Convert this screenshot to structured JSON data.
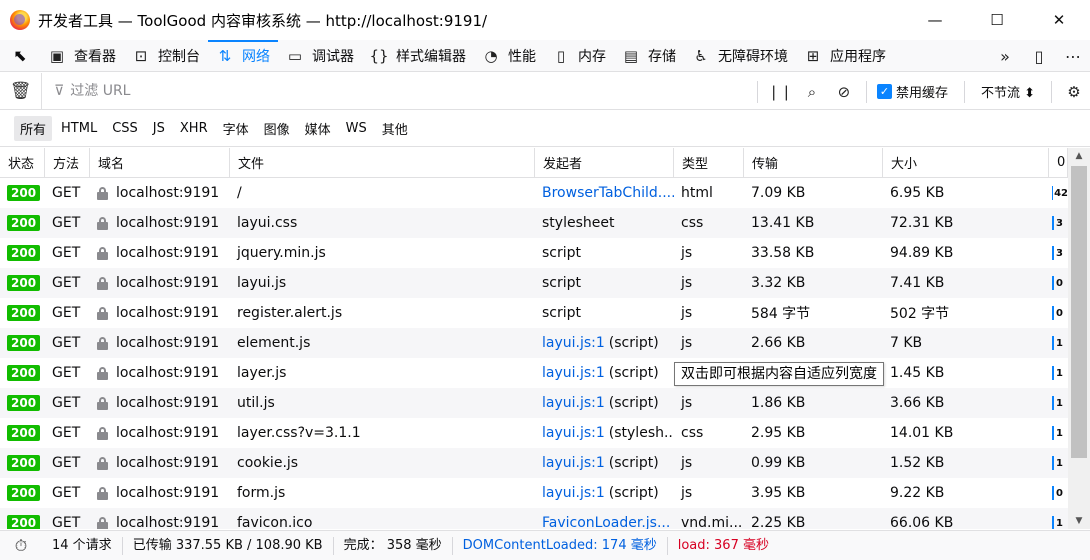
{
  "window": {
    "title": "开发者工具 — ToolGood 内容审核系统 — http://localhost:9191/",
    "buttons": {
      "minimize": "—",
      "maximize": "☐",
      "close": "✕"
    }
  },
  "toolbox": {
    "tabs": [
      {
        "label": "查看器",
        "icon": "inspector-icon"
      },
      {
        "label": "控制台",
        "icon": "console-icon"
      },
      {
        "label": "网络",
        "icon": "network-icon",
        "active": true
      },
      {
        "label": "调试器",
        "icon": "debugger-icon"
      },
      {
        "label": "样式编辑器",
        "icon": "style-editor-icon"
      },
      {
        "label": "性能",
        "icon": "performance-icon"
      },
      {
        "label": "内存",
        "icon": "memory-icon"
      },
      {
        "label": "存储",
        "icon": "storage-icon"
      },
      {
        "label": "无障碍环境",
        "icon": "accessibility-icon"
      },
      {
        "label": "应用程序",
        "icon": "application-icon"
      }
    ]
  },
  "filter": {
    "placeholder": "过滤 URL",
    "disable_cache_label": "禁用缓存",
    "disable_cache_checked": true,
    "throttle_label": "不节流 ⬍"
  },
  "type_filters": [
    "所有",
    "HTML",
    "CSS",
    "JS",
    "XHR",
    "字体",
    "图像",
    "媒体",
    "WS",
    "其他"
  ],
  "columns": {
    "status": "状态",
    "method": "方法",
    "domain": "域名",
    "file": "文件",
    "initiator": "发起者",
    "type": "类型",
    "transferred": "传输",
    "size": "大小",
    "waterfall": "0"
  },
  "requests": [
    {
      "status": "200",
      "method": "GET",
      "domain": "localhost:9191",
      "file": "/",
      "initiator_link": "BrowserTabChild....",
      "initiator_rest": "",
      "type": "html",
      "transferred": "7.09 KB",
      "size": "6.95 KB",
      "waterfall": "42"
    },
    {
      "status": "200",
      "method": "GET",
      "domain": "localhost:9191",
      "file": "layui.css",
      "initiator_link": "",
      "initiator_rest": "stylesheet",
      "type": "css",
      "transferred": "13.41 KB",
      "size": "72.31 KB",
      "waterfall": "3"
    },
    {
      "status": "200",
      "method": "GET",
      "domain": "localhost:9191",
      "file": "jquery.min.js",
      "initiator_link": "",
      "initiator_rest": "script",
      "type": "js",
      "transferred": "33.58 KB",
      "size": "94.89 KB",
      "waterfall": "3"
    },
    {
      "status": "200",
      "method": "GET",
      "domain": "localhost:9191",
      "file": "layui.js",
      "initiator_link": "",
      "initiator_rest": "script",
      "type": "js",
      "transferred": "3.32 KB",
      "size": "7.41 KB",
      "waterfall": "0"
    },
    {
      "status": "200",
      "method": "GET",
      "domain": "localhost:9191",
      "file": "register.alert.js",
      "initiator_link": "",
      "initiator_rest": "script",
      "type": "js",
      "transferred": "584 字节",
      "size": "502 字节",
      "waterfall": "0"
    },
    {
      "status": "200",
      "method": "GET",
      "domain": "localhost:9191",
      "file": "element.js",
      "initiator_link": "layui.js:1",
      "initiator_rest": "(script)",
      "type": "js",
      "transferred": "2.66 KB",
      "size": "7 KB",
      "waterfall": "1"
    },
    {
      "status": "200",
      "method": "GET",
      "domain": "localhost:9191",
      "file": "layer.js",
      "initiator_link": "layui.js:1",
      "initiator_rest": "(script)",
      "type": "js",
      "transferred": "",
      "size": "1.45 KB",
      "waterfall": "1"
    },
    {
      "status": "200",
      "method": "GET",
      "domain": "localhost:9191",
      "file": "util.js",
      "initiator_link": "layui.js:1",
      "initiator_rest": "(script)",
      "type": "js",
      "transferred": "1.86 KB",
      "size": "3.66 KB",
      "waterfall": "1"
    },
    {
      "status": "200",
      "method": "GET",
      "domain": "localhost:9191",
      "file": "layer.css?v=3.1.1",
      "initiator_link": "layui.js:1",
      "initiator_rest": "(stylesh...",
      "type": "css",
      "transferred": "2.95 KB",
      "size": "14.01 KB",
      "waterfall": "1"
    },
    {
      "status": "200",
      "method": "GET",
      "domain": "localhost:9191",
      "file": "cookie.js",
      "initiator_link": "layui.js:1",
      "initiator_rest": "(script)",
      "type": "js",
      "transferred": "0.99 KB",
      "size": "1.52 KB",
      "waterfall": "1"
    },
    {
      "status": "200",
      "method": "GET",
      "domain": "localhost:9191",
      "file": "form.js",
      "initiator_link": "layui.js:1",
      "initiator_rest": "(script)",
      "type": "js",
      "transferred": "3.95 KB",
      "size": "9.22 KB",
      "waterfall": "0"
    },
    {
      "status": "200",
      "method": "GET",
      "domain": "localhost:9191",
      "file": "favicon.ico",
      "initiator_link": "FaviconLoader.js...",
      "initiator_rest": "",
      "type": "vnd.mi...",
      "transferred": "2.25 KB",
      "size": "66.06 KB",
      "waterfall": "1"
    }
  ],
  "tooltip": "双击即可根据内容自适应列宽度",
  "statusbar": {
    "requests": "14 个请求",
    "transferred": "已传输 337.55 KB / 108.90 KB",
    "finish": "完成： 358 毫秒",
    "dom": "DOMContentLoaded: 174 毫秒",
    "load": "load: 367 毫秒"
  },
  "colors": {
    "accent": "#0a84ff",
    "status_ok": "#12bc00",
    "link": "#0060df",
    "load": "#d70022"
  }
}
